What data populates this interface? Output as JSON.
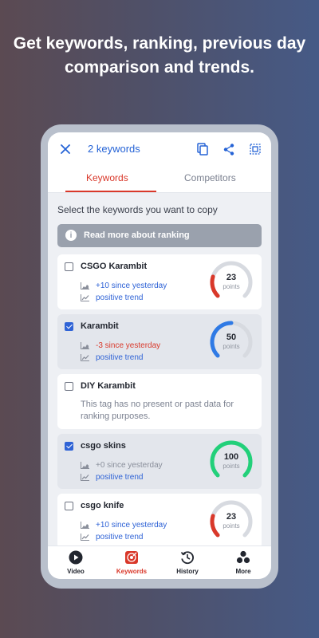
{
  "headline": "Get keywords, ranking, previous day comparison and trends.",
  "topbar": {
    "title": "2 keywords",
    "icons": [
      "close-icon",
      "copy-icon",
      "share-icon",
      "select-all-icon"
    ]
  },
  "tabs": [
    {
      "label": "Keywords",
      "active": true
    },
    {
      "label": "Competitors",
      "active": false
    }
  ],
  "instruction": "Select the keywords you want to copy",
  "banner": {
    "label": "Read more about ranking",
    "icon": "info-icon"
  },
  "keywords": [
    {
      "name": "CSGO Karambit",
      "checked": false,
      "change": "+10 since yesterday",
      "change_color": "#2f63d6",
      "trend": "positive trend",
      "points": "23",
      "points_value": 23,
      "gauge_color": "#d9382a"
    },
    {
      "name": "Karambit",
      "checked": true,
      "change": "-3 since yesterday",
      "change_color": "#d9382a",
      "trend": "positive trend",
      "points": "50",
      "points_value": 50,
      "gauge_color": "#2f7ae5"
    },
    {
      "name": "DIY Karambit",
      "checked": false,
      "no_data": "This tag has no present or past data for ranking purposes."
    },
    {
      "name": "csgo skins",
      "checked": true,
      "change": "+0 since yesterday",
      "change_color": "#8a8f9b",
      "trend": "positive trend",
      "points": "100",
      "points_value": 100,
      "gauge_color": "#22d07a"
    },
    {
      "name": "csgo knife",
      "checked": false,
      "change": "+10 since yesterday",
      "change_color": "#2f63d6",
      "trend": "positive trend",
      "points": "23",
      "points_value": 23,
      "gauge_color": "#d9382a"
    }
  ],
  "points_unit": "points",
  "nav": [
    {
      "label": "Video",
      "icon": "play-icon",
      "active": false
    },
    {
      "label": "Keywords",
      "icon": "target-icon",
      "active": true
    },
    {
      "label": "History",
      "icon": "history-icon",
      "active": false
    },
    {
      "label": "More",
      "icon": "more-icon",
      "active": false
    }
  ],
  "colors": {
    "accent": "#d9382a",
    "link": "#2563d6",
    "positive": "#22d07a",
    "track": "#d7dae0"
  }
}
